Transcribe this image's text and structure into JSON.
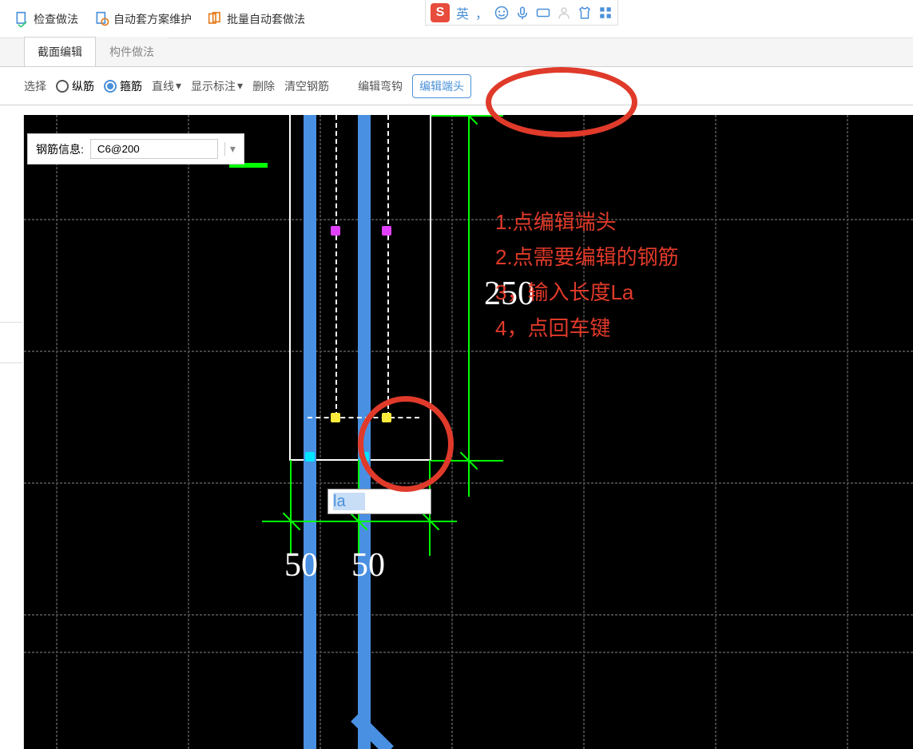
{
  "toolbar": {
    "check_method": "检查做法",
    "auto_scheme_maintain": "自动套方案维护",
    "batch_auto_apply": "批量自动套做法"
  },
  "ime": {
    "lang": "英",
    "logo": "S"
  },
  "tabs": {
    "section_edit": "截面编辑",
    "component_method": "构件做法"
  },
  "actions": {
    "select": "选择",
    "longitudinal": "纵筋",
    "stirrup": "箍筋",
    "line_type": "直线",
    "show_annotation": "显示标注",
    "delete": "删除",
    "clear_rebar": "清空钢筋",
    "edit_hook": "编辑弯钩",
    "edit_end": "编辑端头"
  },
  "info": {
    "label": "钢筋信息:",
    "value": "C6@200"
  },
  "canvas": {
    "dim_250": "250",
    "dim_50_1": "50",
    "dim_50_2": "50",
    "input_value": "la"
  },
  "annotations": {
    "line1": "1.点编辑端头",
    "line2": "2.点需要编辑的钢筋",
    "line3": "3，输入长度La",
    "line4": "4，点回车键"
  }
}
